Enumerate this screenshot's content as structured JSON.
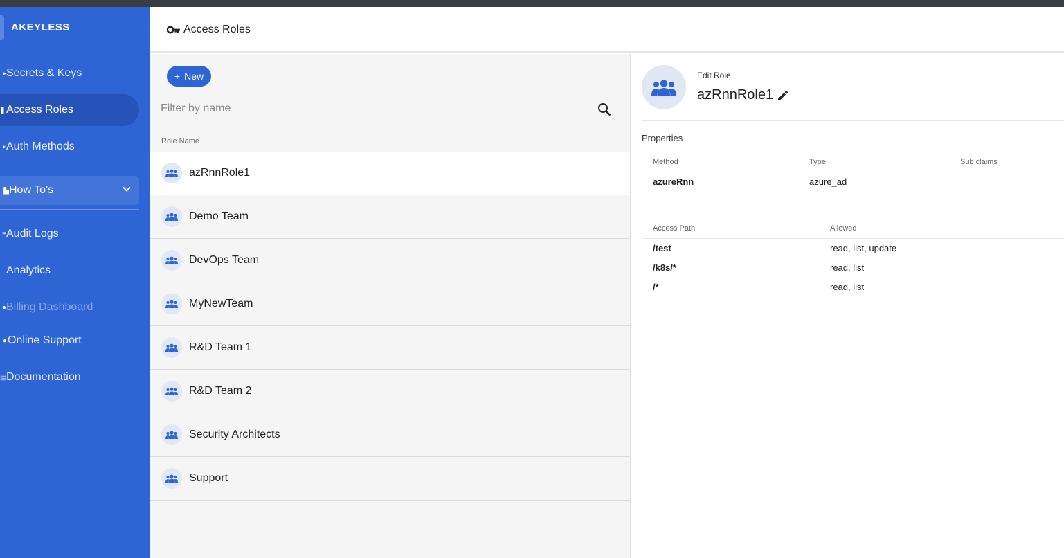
{
  "app": {
    "logo_text": "AKEYLESS"
  },
  "sidebar": {
    "items": [
      {
        "label": "Secrets & Keys",
        "icon": "key-icon"
      },
      {
        "label": "Access Roles",
        "icon": "roles-icon",
        "active": true
      },
      {
        "label": "Auth Methods",
        "icon": "lock-icon"
      },
      {
        "label": "How To's",
        "icon": "book-icon"
      },
      {
        "label": "Audit Logs",
        "icon": "list-icon"
      },
      {
        "label": "Analytics",
        "icon": "chart-icon"
      },
      {
        "label": "Billing Dashboard",
        "icon": "billing-icon",
        "disabled": true
      },
      {
        "label": "Online Support",
        "icon": "support-icon"
      },
      {
        "label": "Documentation",
        "icon": "document-icon"
      }
    ]
  },
  "header": {
    "title": "Access Roles"
  },
  "list": {
    "new_label": "New",
    "filter_placeholder": "Filter by name",
    "column_header": "Role Name",
    "roles": [
      "azRnnRole1",
      "Demo Team",
      "DevOps Team",
      "MyNewTeam",
      "R&D Team 1",
      "R&D Team 2",
      "Security Architects",
      "Support"
    ],
    "selected": "azRnnRole1"
  },
  "detail": {
    "edit_label": "Edit Role",
    "role_name": "azRnnRole1",
    "properties_label": "Properties",
    "auth_table": {
      "headers": [
        "Method",
        "Type",
        "Sub claims"
      ],
      "rows": [
        {
          "method": "azureRnn",
          "type": "azure_ad",
          "sub_claims": ""
        }
      ]
    },
    "access_table": {
      "headers": [
        "Access Path",
        "Allowed"
      ],
      "rows": [
        {
          "path": "/test",
          "allowed": "read, list, update"
        },
        {
          "path": "/k8s/*",
          "allowed": "read, list"
        },
        {
          "path": "/*",
          "allowed": "read, list"
        }
      ]
    }
  },
  "colors": {
    "brand_blue": "#2f64d4",
    "active_nav": "#2653b8",
    "avatar_bg": "#e1e7f3"
  }
}
